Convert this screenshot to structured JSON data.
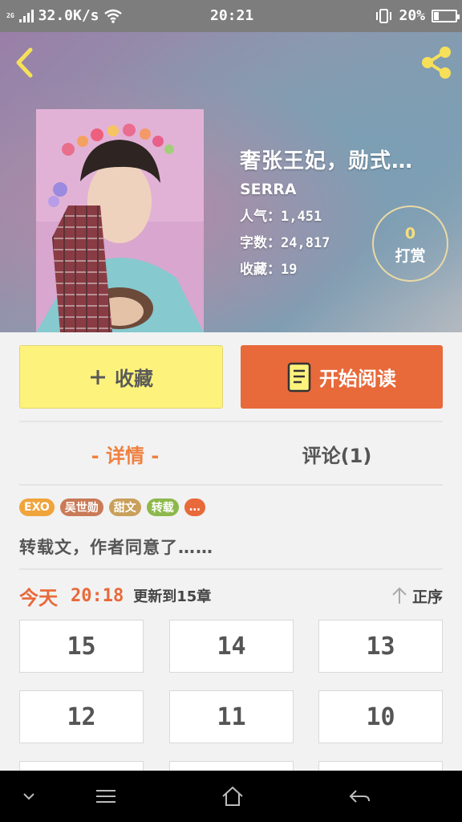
{
  "status_bar": {
    "network_type": "2G",
    "speed": "32.0K/s",
    "time": "20:21",
    "battery_percent": "20%",
    "battery_level": 0.2
  },
  "book": {
    "title": "奢张王妃，勋式…",
    "author": "SERRA",
    "popularity": "人气：1,451",
    "word_count": "字数：24,817",
    "favorites": "收藏：19"
  },
  "reward": {
    "count": "0",
    "label": "打赏"
  },
  "actions": {
    "favorite_label": "收藏",
    "read_label": "开始阅读"
  },
  "tabs": [
    {
      "label": "- 详情 -",
      "active": true
    },
    {
      "label": "评论(1)",
      "active": false
    }
  ],
  "tags": [
    {
      "label": "EXO",
      "color": "#f0a43c"
    },
    {
      "label": "吴世勋",
      "color": "#c97a56"
    },
    {
      "label": "甜文",
      "color": "#c9a05a"
    },
    {
      "label": "转载",
      "color": "#8db84a"
    },
    {
      "label": "…",
      "color": "#e8693a"
    }
  ],
  "summary": "转载文，作者同意了……",
  "update": {
    "day": "今天",
    "time": "20:18",
    "text": "更新到15章",
    "sort_label": "正序"
  },
  "chapters": [
    "15",
    "14",
    "13",
    "12",
    "11",
    "10"
  ],
  "colors": {
    "accent": "#e8693a",
    "favorite_bg": "#fdf37c",
    "reward_count": "#f5df7c"
  },
  "icons": {
    "back": "chevron-left-icon",
    "share": "share-icon",
    "add": "plus-icon",
    "read": "book-icon",
    "sort": "arrow-up-icon",
    "nav": [
      "chevron-down-icon",
      "menu-icon",
      "home-icon",
      "back-arrow-icon"
    ]
  }
}
